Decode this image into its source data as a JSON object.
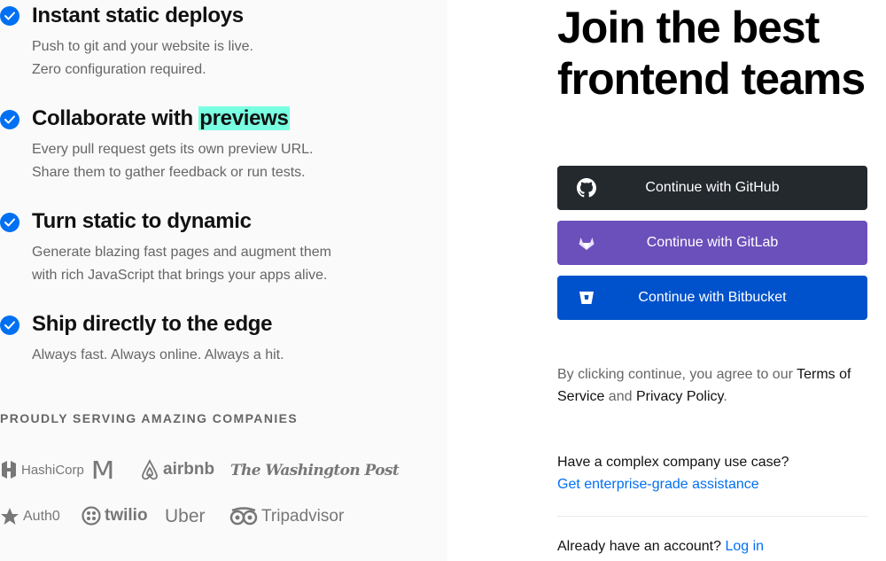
{
  "features": [
    {
      "title": "Instant static deploys",
      "desc1": "Push to git and your website is live.",
      "desc2": "Zero configuration required."
    },
    {
      "title_pre": "Collaborate with ",
      "title_hl": "previews",
      "desc1": "Every pull request gets its own preview URL.",
      "desc2": "Share them to gather feedback or run tests."
    },
    {
      "title": "Turn static to dynamic",
      "desc1": "Generate blazing fast pages and augment them",
      "desc2": "with rich JavaScript that brings your apps alive."
    },
    {
      "title": "Ship directly to the edge",
      "desc1": "Always fast. Always online. Always a hit."
    }
  ],
  "serving_heading": "PROUDLY SERVING AMAZING COMPANIES",
  "logos": {
    "hashicorp": "HashiCorp",
    "mcdonalds": "M",
    "airbnb": "airbnb",
    "washpost": "The Washington Post",
    "auth0": "Auth0",
    "twilio": "twilio",
    "uber": "Uber",
    "tripadvisor": "Tripadvisor"
  },
  "join": {
    "line1": "Join the best",
    "line2": "frontend teams"
  },
  "buttons": {
    "github": "Continue with GitHub",
    "gitlab": "Continue with GitLab",
    "bitbucket": "Continue with Bitbucket"
  },
  "colors": {
    "github": "#24292e",
    "gitlab": "#6b4fbb",
    "bitbucket": "#0052cc",
    "accent": "#0070f3",
    "highlight": "#79ffe1"
  },
  "legal": {
    "pre": "By clicking continue, you agree to our ",
    "terms": "Terms of Service",
    "and": " and ",
    "privacy": "Privacy Policy",
    "end": "."
  },
  "enterprise": {
    "question": "Have a complex company use case?",
    "link": "Get enterprise-grade assistance"
  },
  "login": {
    "question": "Already have an account? ",
    "link": "Log in"
  }
}
